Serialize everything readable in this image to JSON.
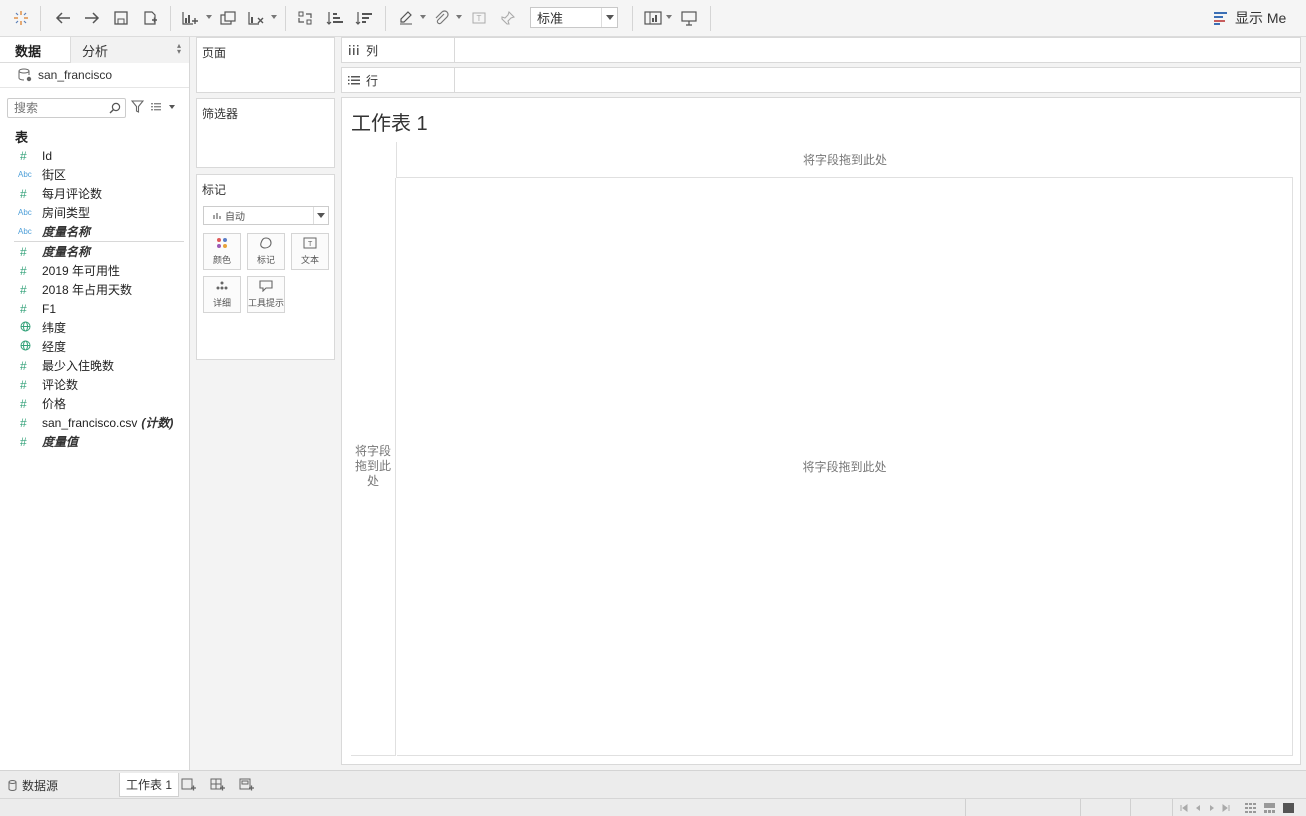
{
  "toolbar": {
    "fit_value": "标准",
    "show_me_label": "显示 Me"
  },
  "data_pane": {
    "tabs": [
      "数据",
      "分析"
    ],
    "datasource": "san_francisco",
    "search_placeholder": "搜索",
    "tables_header": "表",
    "dimensions": [
      {
        "icon": "#",
        "label": "Id",
        "type": "measure"
      },
      {
        "icon": "Abc",
        "label": "街区",
        "type": "dimension"
      },
      {
        "icon": "#",
        "label": "每月评论数",
        "type": "measure"
      },
      {
        "icon": "Abc",
        "label": "房间类型",
        "type": "dimension"
      },
      {
        "icon": "Abc",
        "label": "度量名称",
        "type": "dimension-italic"
      }
    ],
    "measures": [
      {
        "icon": "#",
        "label": "度量名称",
        "type": "measure-italic"
      },
      {
        "icon": "#",
        "label": "2019 年可用性",
        "type": "measure"
      },
      {
        "icon": "#",
        "label": "2018 年占用天数",
        "type": "measure"
      },
      {
        "icon": "#",
        "label": "F1",
        "type": "measure"
      },
      {
        "icon": "globe",
        "label": "纬度",
        "type": "geo"
      },
      {
        "icon": "globe",
        "label": "经度",
        "type": "geo"
      },
      {
        "icon": "#",
        "label": "最少入住晚数",
        "type": "measure"
      },
      {
        "icon": "#",
        "label": "评论数",
        "type": "measure"
      },
      {
        "icon": "#",
        "label": "价格",
        "type": "measure"
      },
      {
        "icon": "#",
        "label": "san_francisco.csv",
        "suffix": "(计数)",
        "type": "measure"
      },
      {
        "icon": "#",
        "label": "度量值",
        "type": "measure-italic"
      }
    ]
  },
  "cards": {
    "pages": "页面",
    "filters": "筛选器",
    "marks": "标记",
    "marks_type": "自动",
    "mark_buttons": [
      "颜色",
      "标记",
      "文本",
      "详细",
      "工具提示"
    ]
  },
  "shelves": {
    "columns": "列",
    "rows": "行"
  },
  "view": {
    "title": "工作表 1",
    "drop_col": "将字段拖到此处",
    "drop_row": "将字段拖到此处",
    "drop_body": "将字段拖到此处"
  },
  "sheetbar": {
    "datasource_tab": "数据源",
    "sheet_tab": "工作表 1"
  },
  "colors": {
    "measure_green": "#34a27a",
    "dimension_blue": "#4e9fd8",
    "show_me_accent": "#3b6fb5"
  }
}
